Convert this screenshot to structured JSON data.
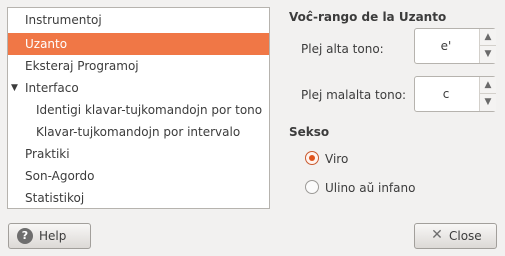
{
  "tree": {
    "items": [
      {
        "label": "Instrumentoj"
      },
      {
        "label": "Uzanto"
      },
      {
        "label": "Eksteraj Programoj"
      },
      {
        "label": "Interfaco"
      },
      {
        "label": "Identigi klavar-tujkomandojn por tono"
      },
      {
        "label": "Klavar-tujkomandojn por intervalo"
      },
      {
        "label": "Praktiki"
      },
      {
        "label": "Son-Agordo"
      },
      {
        "label": "Statistikoj"
      }
    ],
    "selected": "Uzanto",
    "selection_color": "#f07746"
  },
  "voice_range": {
    "title": "Voĉ-rango de la Uzanto",
    "highest_label": "Plej alta tono:",
    "highest_value": "e'",
    "lowest_label": "Plej malalta tono:",
    "lowest_value": "c"
  },
  "sex": {
    "title": "Sekso",
    "options": [
      {
        "label": "Viro",
        "checked": true
      },
      {
        "label": "Ulino aŭ infano",
        "checked": false
      }
    ]
  },
  "buttons": {
    "help_label": "Help",
    "close_label": "Close"
  },
  "icons": {
    "help": "help-icon",
    "close": "close-icon",
    "expander": "triangle-down-icon"
  }
}
